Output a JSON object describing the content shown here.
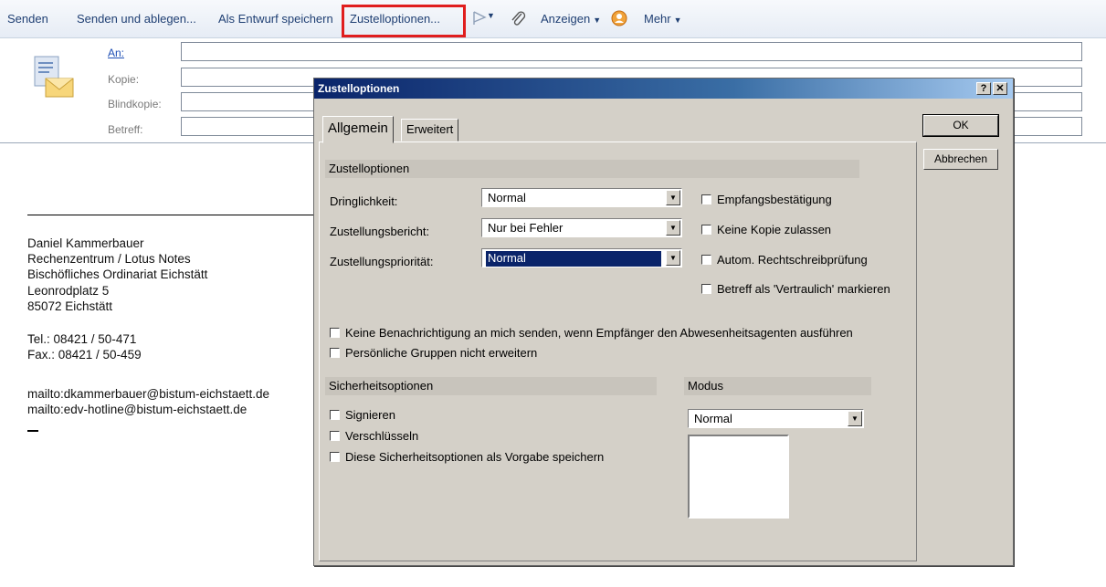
{
  "toolbar": {
    "send": "Senden",
    "send_file": "Senden und ablegen...",
    "save_draft": "Als Entwurf speichern",
    "delivery_options": "Zustelloptionen...",
    "display": "Anzeigen",
    "more": "Mehr",
    "caret": "▼",
    "icons": [
      "flag-icon",
      "paperclip-icon",
      "person-icon"
    ]
  },
  "header": {
    "to_label": "An:",
    "cc_label": "Kopie:",
    "bcc_label": "Blindkopie:",
    "subject_label": "Betreff:",
    "to_value": "",
    "cc_value": "",
    "bcc_value": "",
    "subject_value": ""
  },
  "signature": {
    "name": "Daniel Kammerbauer",
    "dept": "Rechenzentrum / Lotus Notes",
    "org": "Bischöfliches Ordinariat Eichstätt",
    "street": "Leonrodplatz 5",
    "city": "85072 Eichstätt",
    "tel": "Tel.: 08421 / 50-471",
    "fax": "Fax.: 08421 / 50-459",
    "mail1": "mailto:dkammerbauer@bistum-eichstaett.de",
    "mail2": "mailto:edv-hotline@bistum-eichstaett.de"
  },
  "dialog": {
    "title": "Zustelloptionen",
    "help_btn": "?",
    "close_btn": "✕",
    "tabs": [
      "Allgemein",
      "Erweitert"
    ],
    "ok": "OK",
    "cancel": "Abbrechen",
    "section_delivery": "Zustelloptionen",
    "urgency_label": "Dringlichkeit:",
    "urgency_value": "Normal",
    "report_label": "Zustellungsbericht:",
    "report_value": "Nur bei Fehler",
    "priority_label": "Zustellungspriorität:",
    "priority_value": "Normal",
    "cb_receipt": "Empfangsbestätigung",
    "cb_nocopy": "Keine Kopie zulassen",
    "cb_spell": "Autom. Rechtschreibprüfung",
    "cb_confidential": "Betreff als 'Vertraulich' markieren",
    "cb_no_notify": "Keine Benachrichtigung an mich senden, wenn Empfänger den Abwesenheitsagenten ausführen",
    "cb_personal_groups": "Persönliche Gruppen nicht erweitern",
    "section_security": "Sicherheitsoptionen",
    "cb_sign": "Signieren",
    "cb_encrypt": "Verschlüsseln",
    "cb_save_default": "Diese Sicherheitsoptionen als Vorgabe speichern",
    "section_mode": "Modus",
    "mode_value": "Normal",
    "dropdown_arrow": "▼"
  },
  "colors": {
    "highlight": "#e01e1e",
    "titlebar": "#0a246a",
    "link": "#1f4fb5",
    "dialog_bg": "#d4d0c8"
  }
}
